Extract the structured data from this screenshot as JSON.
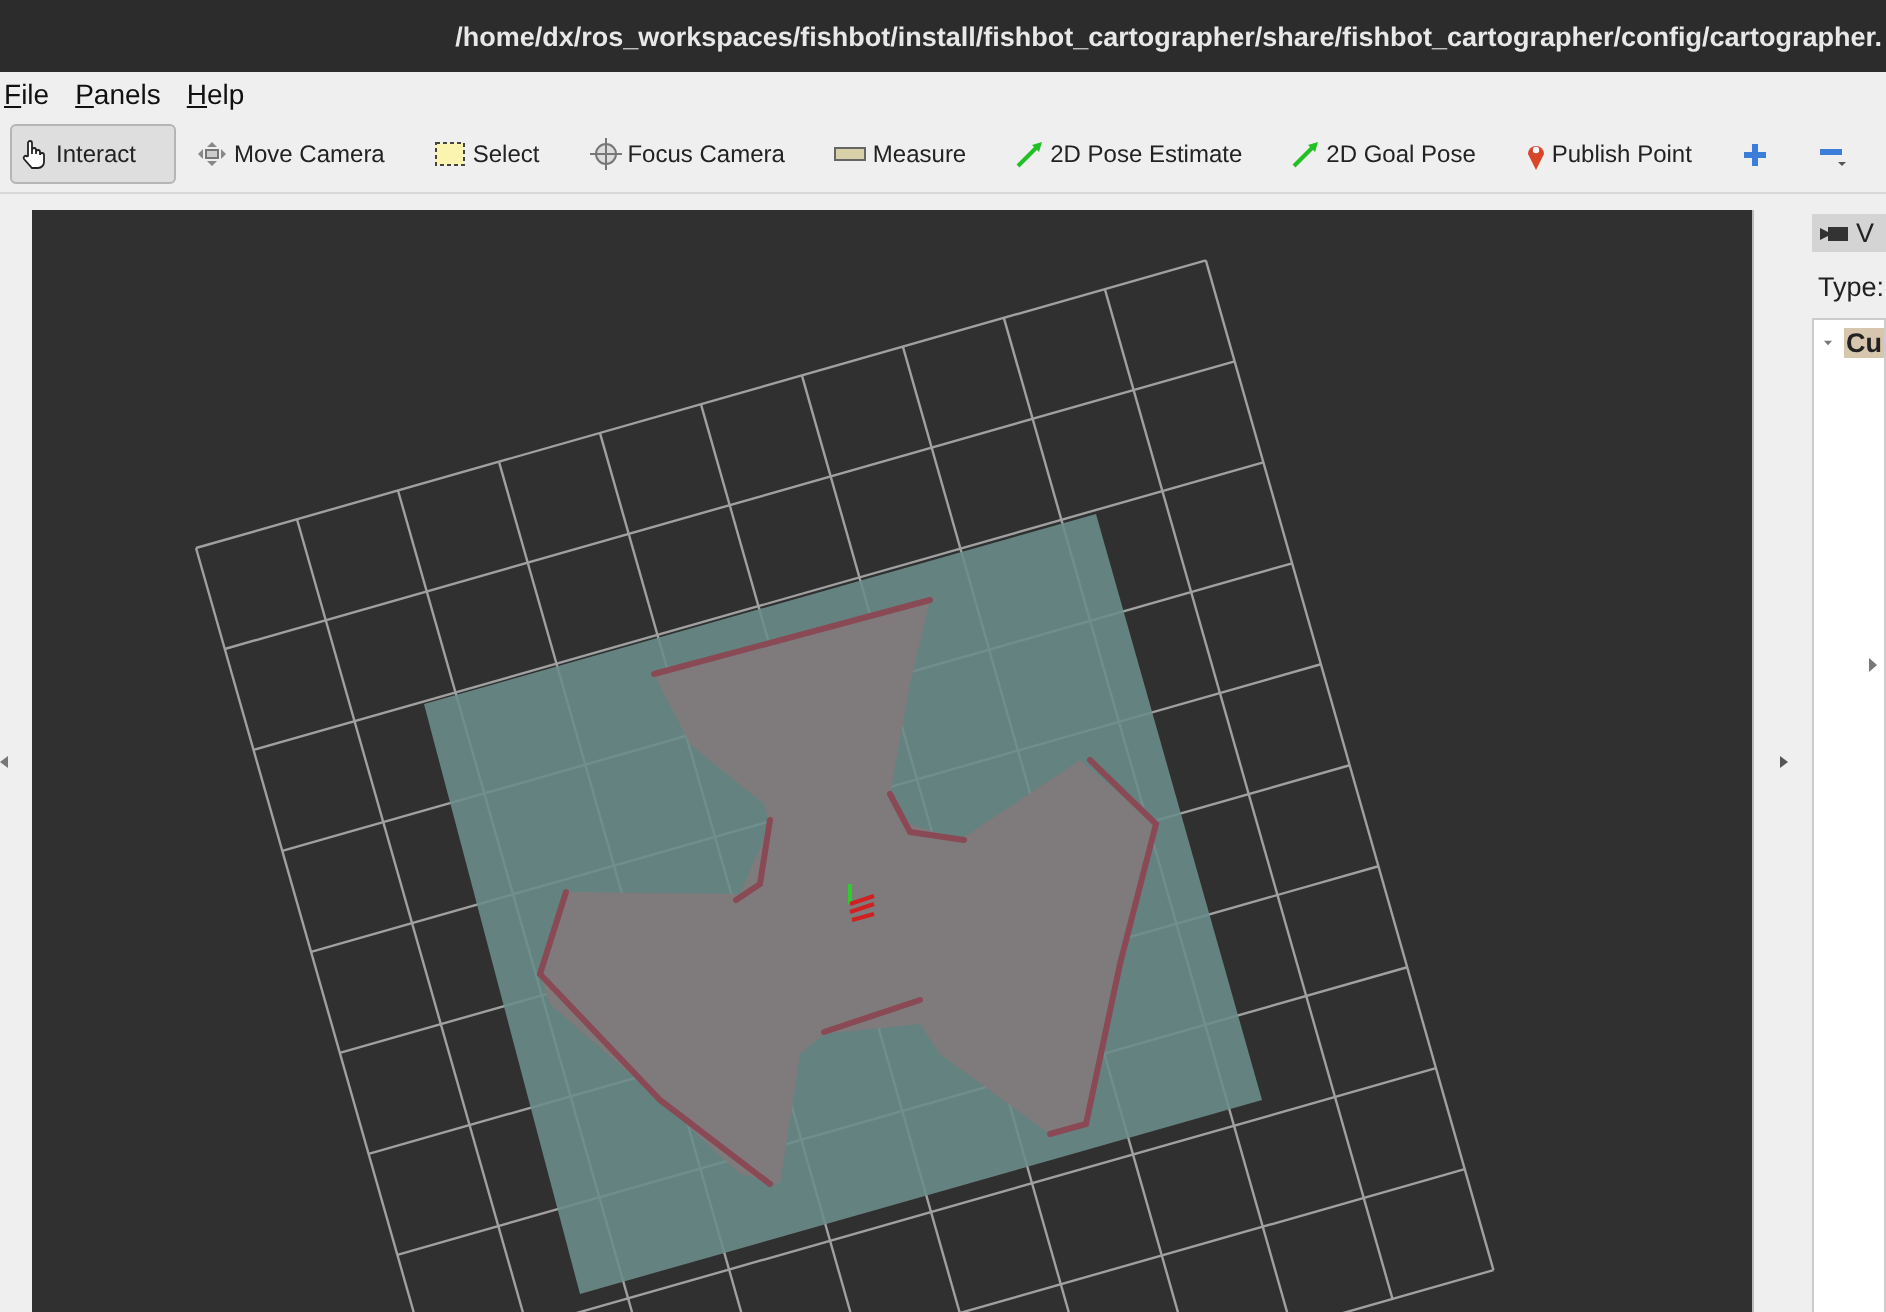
{
  "window": {
    "title": "/home/dx/ros_workspaces/fishbot/install/fishbot_cartographer/share/fishbot_cartographer/config/cartographer."
  },
  "menu": [
    "File",
    "Panels",
    "Help"
  ],
  "toolbar": [
    {
      "kind": "interact",
      "label": "Interact",
      "selected": true
    },
    {
      "kind": "move",
      "label": "Move Camera",
      "selected": false
    },
    {
      "kind": "select",
      "label": "Select",
      "selected": false
    },
    {
      "kind": "focus",
      "label": "Focus Camera",
      "selected": false
    },
    {
      "kind": "measure",
      "label": "Measure",
      "selected": false
    },
    {
      "kind": "pose",
      "label": "2D Pose Estimate",
      "selected": false
    },
    {
      "kind": "pose",
      "label": "2D Goal Pose",
      "selected": false
    },
    {
      "kind": "point",
      "label": "Publish Point",
      "selected": false
    },
    {
      "kind": "add",
      "selected": false
    },
    {
      "kind": "remove",
      "selected": false
    }
  ],
  "views_panel": {
    "title": "V",
    "type_label": "Type:",
    "tree": [
      {
        "label": "Cu",
        "expanded": true,
        "selected": true,
        "children": [
          {
            "expanded": false
          }
        ]
      }
    ]
  }
}
